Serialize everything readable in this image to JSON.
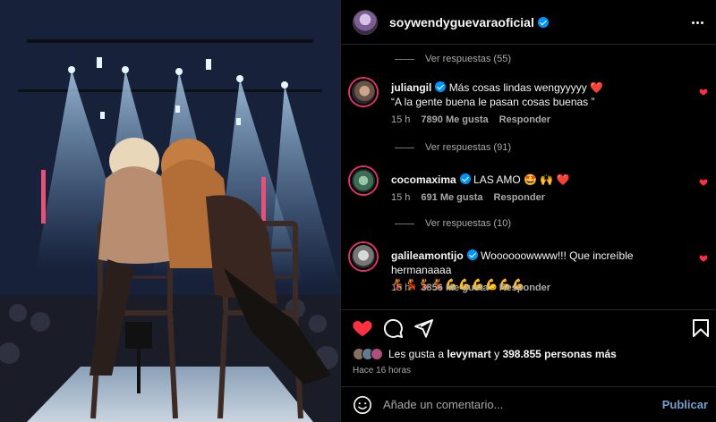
{
  "post": {
    "username": "soywendyguevaraoficial",
    "verified": true,
    "image_alt": "Dos mujeres abrazadas sentadas en sillas sobre un escenario con luces"
  },
  "comments": [
    {
      "view_replies_above": "Ver respuestas (55)"
    },
    {
      "username": "juliangil",
      "verified": true,
      "text_line1": "Más cosas lindas wengyyyyy ❤️",
      "text_line2": "“A la gente buena le pasan cosas buenas ”",
      "time": "15 h",
      "likes": "7890 Me gusta",
      "reply": "Responder",
      "view_replies": "Ver respuestas (91)"
    },
    {
      "username": "cocomaxima",
      "verified": true,
      "text_line1": "LAS AMO 🤩 🙌 ❤️",
      "time": "15 h",
      "likes": "691 Me gusta",
      "reply": "Responder",
      "view_replies": "Ver respuestas (10)"
    },
    {
      "username": "galileamontijo",
      "verified": true,
      "text_line1": "Woooooowwww!!! Que increíble hermanaaaa",
      "text_line2": "💃💃💃💃💪💪💪💪💪💪",
      "time": "15 h",
      "likes": "3856 Me gusta",
      "reply": "Responder"
    }
  ],
  "likes_summary": {
    "prefix": "Les gusta a ",
    "user": "levymart",
    "middle": " y ",
    "count": "398.855 personas más"
  },
  "posted_ago": "Hace 16 horas",
  "composer": {
    "placeholder": "Añade un comentario...",
    "publish_label": "Publicar"
  },
  "icons": [
    "heart-icon",
    "comment-icon",
    "share-icon",
    "bookmark-icon",
    "emoji-icon",
    "more-options-icon"
  ],
  "colors": {
    "like_red": "#ff3040",
    "verified_blue": "#0095f6",
    "publish_blue": "#70a2cf",
    "background": "#000000"
  }
}
